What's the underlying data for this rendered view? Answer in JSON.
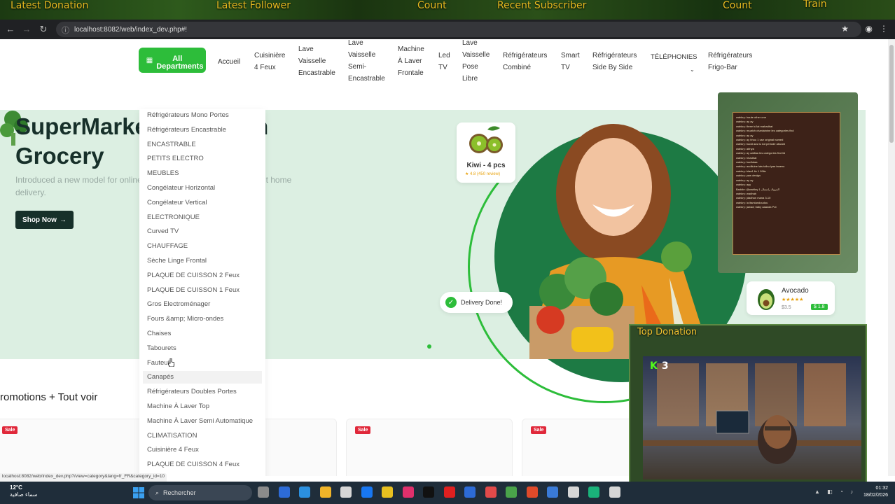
{
  "stream_bar": {
    "latest_donation": "Latest Donation",
    "latest_follower": "Latest Follower",
    "count1": "Count",
    "recent_subscriber": "Recent Subscriber",
    "count2": "Count",
    "train": "Train"
  },
  "browser": {
    "url": "localhost:8082/web/index_dev.php#!",
    "status_url": "localhost:8082/web/index_dev.php?/view=category&lang=fr_FR&category_id=10"
  },
  "nav": {
    "all_button": "All Departments",
    "links": [
      {
        "label": "Accueil"
      },
      {
        "label": "Cuisinière 4 Feux"
      },
      {
        "label": "Lave Vaisselle Encastrable"
      },
      {
        "label": "Lave Vaisselle Semi-Encastrable"
      },
      {
        "label": "Machine À Laver Frontale"
      },
      {
        "label": "Led TV"
      },
      {
        "label": "Lave Vaisselle Pose Libre"
      },
      {
        "label": "Réfrigérateurs Combiné"
      },
      {
        "label": "Smart TV"
      },
      {
        "label": "Réfrigérateurs Side By Side"
      },
      {
        "label": "TÉLÉPHONIES"
      },
      {
        "label": "Réfrigérateurs Frigo-Bar"
      }
    ]
  },
  "dropdown": {
    "items": [
      "Réfrigérateurs Mono Portes",
      "Réfrigérateurs Encastrable",
      "ENCASTRABLE",
      "PETITS ELECTRO",
      "MEUBLES",
      "Congélateur Horizontal",
      "Congélateur Vertical",
      "ELECTRONIQUE",
      "Curved TV",
      "CHAUFFAGE",
      "Sèche Linge Frontal",
      "PLAQUE DE CUISSON 2 Feux",
      "PLAQUE DE CUISSON 1 Feux",
      "Gros Electroménager",
      "Fours &amp; Micro-ondes",
      "Chaises",
      "Tabourets",
      "Fauteuil",
      "Canapés",
      "Réfrigérateurs Doubles Portes",
      "Machine À Laver Top",
      "Machine À Laver Semi Automatique",
      "CLIMATISATION",
      "Cuisinière 4 Feux",
      "PLAQUE DE CUISSON 4 Feux",
      "PLAQUE DE CUISSON 5 Feux"
    ],
    "hovered": "Canapés"
  },
  "hero": {
    "title_line1": "SuperMarket For Fresh",
    "title_line2": "Grocery",
    "subtitle": "Introduced a new model for online grocery shopping and convenient home delivery.",
    "shop_button": "Shop Now",
    "kiwi_label": "Kiwi - 4 pcs",
    "kiwi_rating": "★ 4.8 (450 review)",
    "avocado_label": "Avocado",
    "avocado_stars": "★★★★★",
    "avocado_price": "$3.5",
    "avocado_badge": "$ 1.8",
    "delivery_label": "Delivery Done!"
  },
  "promo": {
    "title": "romotions + Tout voir",
    "sale_badge": "Sale"
  },
  "overlay": {
    "top_donation": "Top Donation",
    "kick_count": "3",
    "chat_lines": [
      "wahkry: haute other one",
      "wahkry: ay ay",
      "wahkry: three tu'lat mahadhat",
      "wahkry: muatch chanlainine les categories fixd",
      "wahkry: ay ay",
      "wahkry: ay hhuu 1 use original named",
      "wahkry: badd aus tu lcd periode abudat",
      "wahkry: abhya",
      "wahkry: ay aatllaa les categories fixd lid",
      "wahkry: hhadhat",
      "wahkry: hadhdaa",
      "wahkry: audiluine lais tolbu lyaa tasenu",
      "wahkry: blaa1 lie 1 99lie",
      "wahkry: yaw design",
      "wahkry: ay ay",
      "wahkry: ayy",
      "Baddie: @wahkry 1 المروك راسمال",
      "wahkry: wadhab",
      "wahkry: jdadhun mana 3-10",
      "wahkry: ia itamiandoudou",
      "wahkry: jawad; baby aaasda Pot"
    ]
  },
  "taskbar": {
    "temp": "12°C",
    "weather_desc": "سماء صافية",
    "search": "Rechercher",
    "time": "01:32",
    "date": "18/02/2026"
  }
}
